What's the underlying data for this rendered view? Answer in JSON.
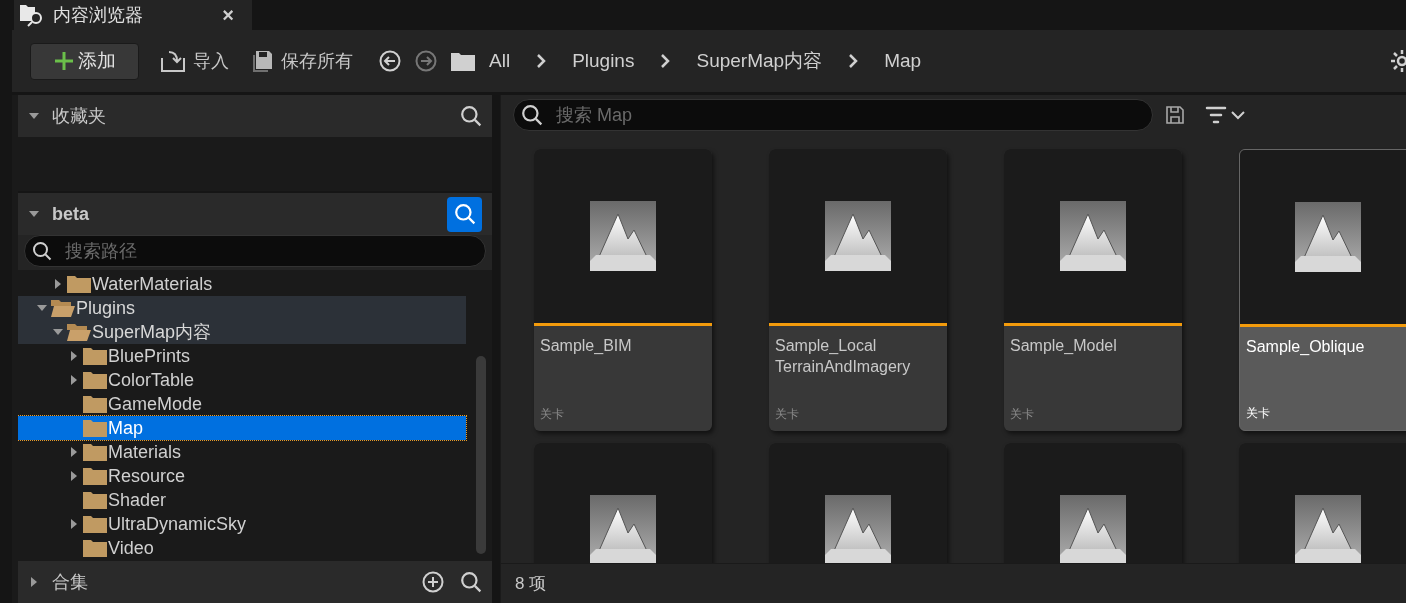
{
  "tab": {
    "title": "内容浏览器",
    "close": "×"
  },
  "toolbar": {
    "add": "添加",
    "import": "导入",
    "save_all": "保存所有",
    "breadcrumbs": [
      "All",
      "Plugins",
      "SuperMap内容",
      "Map"
    ]
  },
  "favorites": {
    "title": "收藏夹",
    "expanded": true
  },
  "source": {
    "title": "beta",
    "expanded": true,
    "search_active": true,
    "search_placeholder": "搜索路径",
    "tree": [
      {
        "children": [
          {
            "label": "WaterMaterials",
            "expandable": true,
            "expanded": false,
            "selected": false
          }
        ]
      },
      {
        "label": "Plugins",
        "expandable": true,
        "expanded": true,
        "selected": false,
        "children": [
          {
            "label": "SuperMap内容",
            "expandable": true,
            "expanded": true,
            "selected": false,
            "children": [
              {
                "label": "BluePrints",
                "expandable": true,
                "expanded": false,
                "selected": false
              },
              {
                "label": "ColorTable",
                "expandable": true,
                "expanded": false,
                "selected": false
              },
              {
                "label": "GameMode",
                "expandable": false,
                "expanded": false,
                "selected": false
              },
              {
                "label": "Map",
                "expandable": false,
                "expanded": false,
                "selected": true
              },
              {
                "label": "Materials",
                "expandable": true,
                "expanded": false,
                "selected": false
              },
              {
                "label": "Resource",
                "expandable": true,
                "expanded": false,
                "selected": false
              },
              {
                "label": "Shader",
                "expandable": false,
                "expanded": false,
                "selected": false
              },
              {
                "label": "UltraDynamicSky",
                "expandable": true,
                "expanded": false,
                "selected": false
              },
              {
                "label": "Video",
                "expandable": false,
                "expanded": false,
                "selected": false
              }
            ]
          }
        ]
      }
    ]
  },
  "collections": {
    "title": "合集",
    "expanded": false
  },
  "assets": {
    "search_placeholder": "搜索 Map",
    "items": [
      {
        "name": "Sample_BIM",
        "type": "关卡",
        "selected": false
      },
      {
        "name": "Sample_Local\nTerrainAndImagery",
        "type": "关卡",
        "selected": false
      },
      {
        "name": "Sample_Model",
        "type": "关卡",
        "selected": false
      },
      {
        "name": "Sample_Oblique",
        "type": "关卡",
        "selected": true
      },
      {
        "selected": false
      },
      {
        "selected": false
      },
      {
        "selected": false
      },
      {
        "selected": false
      }
    ]
  },
  "status_bar": {
    "count": "8 项"
  }
}
